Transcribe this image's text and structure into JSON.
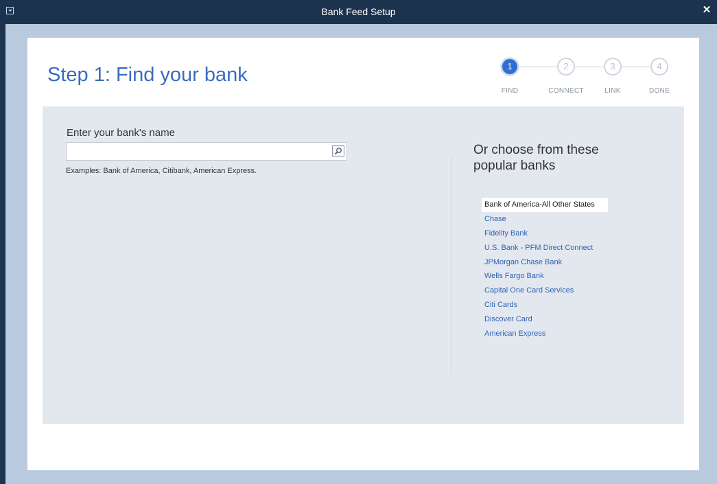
{
  "window": {
    "title": "Bank Feed Setup"
  },
  "header": {
    "title": "Step 1: Find your bank"
  },
  "stepper": {
    "steps": [
      {
        "number": "1",
        "label": "FIND",
        "active": true
      },
      {
        "number": "2",
        "label": "CONNECT",
        "active": false
      },
      {
        "number": "3",
        "label": "LINK",
        "active": false
      },
      {
        "number": "4",
        "label": "DONE",
        "active": false
      }
    ]
  },
  "search": {
    "label": "Enter your bank's name",
    "value": "",
    "placeholder": "",
    "examples": "Examples: Bank of America, Citibank, American Express."
  },
  "popular": {
    "heading": "Or choose from these popular banks",
    "selected_index": 0,
    "banks": [
      "Bank of America-All Other States",
      "Chase",
      "Fidelity Bank",
      "U.S. Bank -  PFM Direct Connect",
      "JPMorgan Chase Bank",
      "Wells Fargo Bank",
      "Capital One Card Services",
      "Citi Cards",
      "Discover Card",
      "American Express"
    ]
  },
  "colors": {
    "titlebar": "#1c3350",
    "accent": "#3a6bc1",
    "link": "#2d62b8",
    "panel": "#e3e8ef",
    "frame": "#b9cade"
  },
  "icons": {
    "system_menu": "system-menu-icon",
    "close": "close-icon",
    "search": "magnifier-icon"
  }
}
